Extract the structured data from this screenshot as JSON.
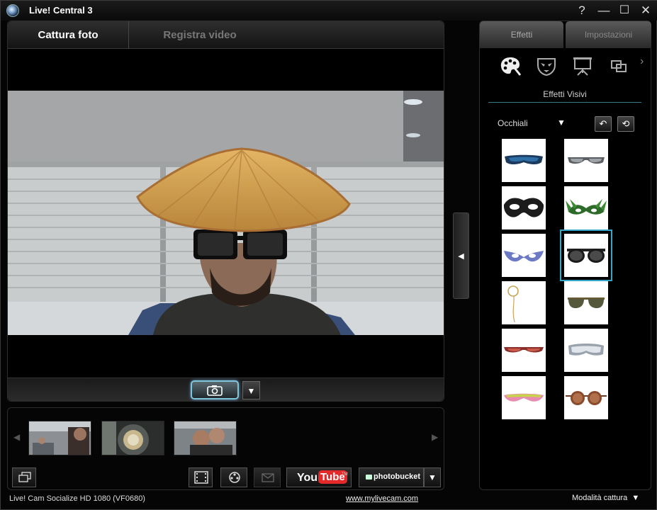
{
  "app": {
    "title": "Live! Central 3"
  },
  "window": {
    "help": "?",
    "minimize": "—",
    "maximize": "☐",
    "close": "✕"
  },
  "tabs": [
    {
      "label": "Cattura foto"
    },
    {
      "label": "Registra video"
    }
  ],
  "controls": {
    "capture_dropdown": "▼",
    "collapse": "◀"
  },
  "strip": {
    "left_arrow": "◀",
    "right_arrow": "▶",
    "buttons": {
      "film": "film-icon",
      "reel": "reel-icon",
      "mail": "mail-icon",
      "youtube": "You",
      "youtube_tube": "Tube",
      "youtube_tm": "TM",
      "photobucket": "photobucket",
      "dropdown": "▼"
    }
  },
  "right": {
    "tabs": [
      {
        "label": "Effetti"
      },
      {
        "label": "Impostazioni"
      }
    ],
    "icons": [
      "palette-icon",
      "mask-icon",
      "presentation-icon",
      "overlay-icon"
    ],
    "more": "›",
    "section_title": "Effetti Visivi",
    "category": "Occhiali",
    "category_dd": "▼",
    "undo": "↶",
    "reset": "⟲",
    "effects": [
      "blue-goggles",
      "silver-sunglasses",
      "black-mask",
      "green-feather-mask",
      "blue-feather-mask",
      "black-sunglasses",
      "monocle",
      "green-aviators",
      "red-sunglasses",
      "ski-goggles",
      "rainbow-glasses",
      "round-brown-glasses"
    ],
    "selected_index": 5
  },
  "status": {
    "device": "Live! Cam Socialize HD 1080 (VF0680)",
    "link": "www.mylivecam.com",
    "mode": "Modalità cattura",
    "mode_dd": "▼"
  },
  "colors": {
    "accent": "#36a6c8",
    "panel_border": "#2d2d2d",
    "youtube_red": "#e4292b"
  }
}
